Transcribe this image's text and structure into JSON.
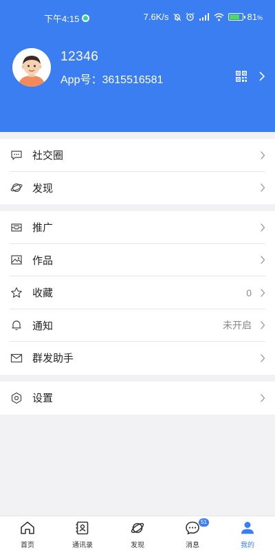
{
  "status_bar": {
    "time": "下午4:15",
    "network_speed": "7.6K/s",
    "battery_percent": "81",
    "battery_level": 0.81
  },
  "profile": {
    "name": "12346",
    "app_id": "App号：3615516581"
  },
  "menu_groups": [
    {
      "items": [
        {
          "label": "社交圈",
          "icon": "chat-bubble-icon",
          "value": ""
        },
        {
          "label": "发现",
          "icon": "planet-icon",
          "value": ""
        }
      ]
    },
    {
      "items": [
        {
          "label": "推广",
          "icon": "inbox-icon",
          "value": ""
        },
        {
          "label": "作品",
          "icon": "image-icon",
          "value": ""
        },
        {
          "label": "收藏",
          "icon": "star-icon",
          "value": "0"
        },
        {
          "label": "通知",
          "icon": "bell-icon",
          "value": "未开启"
        },
        {
          "label": "群发助手",
          "icon": "mail-icon",
          "value": ""
        }
      ]
    },
    {
      "items": [
        {
          "label": "设置",
          "icon": "gear-icon",
          "value": ""
        }
      ]
    }
  ],
  "tabbar": {
    "tabs": [
      {
        "label": "首页",
        "icon": "home-icon"
      },
      {
        "label": "通讯录",
        "icon": "contacts-icon"
      },
      {
        "label": "发现",
        "icon": "discover-icon"
      },
      {
        "label": "消息",
        "icon": "message-icon",
        "badge": "51"
      },
      {
        "label": "我的",
        "icon": "person-icon",
        "active": true
      }
    ]
  },
  "colors": {
    "accent": "#3b7ef2",
    "background": "#f2f2f4"
  }
}
